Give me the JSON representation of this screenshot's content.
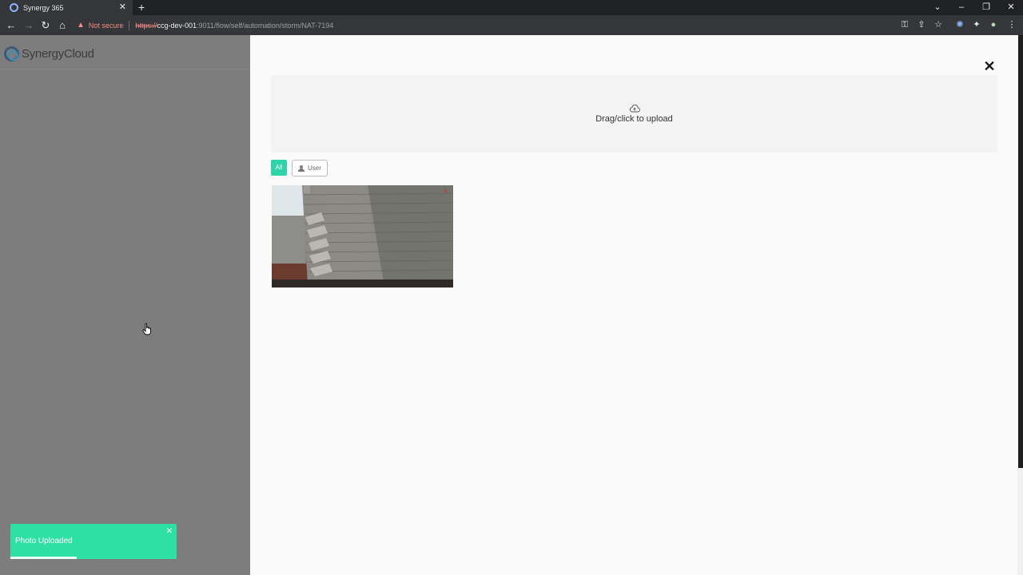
{
  "browser": {
    "tab_title": "Synergy 365",
    "security_label": "Not secure",
    "url_scheme": "https://",
    "url_host": "ccg-dev-001",
    "url_path": ":9011/flow/self/automation/storm/NAT-7194"
  },
  "app": {
    "logo_text_left": "Synergy",
    "logo_text_right": "Cloud"
  },
  "modal": {
    "upload_label": "Drag/click to upload",
    "filter_all": "All",
    "filter_user": "User"
  },
  "toast": {
    "message": "Photo Uploaded",
    "progress": 0.4
  },
  "colors": {
    "accent": "#2ed3a7",
    "toast": "#2ee0a3",
    "sidebar_overlay": "#7d7d7d"
  }
}
